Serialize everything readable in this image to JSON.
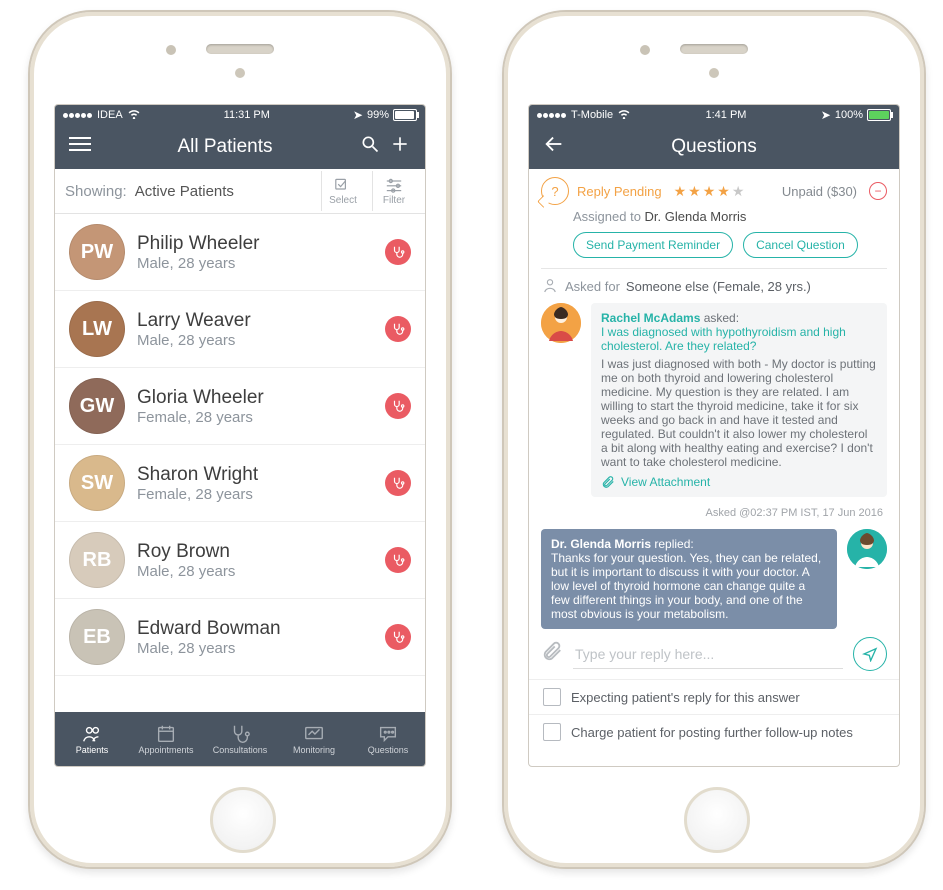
{
  "left": {
    "status": {
      "carrier": "IDEA",
      "time": "11:31 PM",
      "battery_pct": "99%",
      "battery_color": "#ffffff",
      "battery_fill": 95
    },
    "header": {
      "title": "All Patients"
    },
    "filter": {
      "showing_label": "Showing:",
      "showing_value": "Active Patients",
      "select_label": "Select",
      "filter_label": "Filter"
    },
    "patients": [
      {
        "name": "Philip Wheeler",
        "sub": "Male, 28 years",
        "initials": "PW",
        "bg": "#c49676"
      },
      {
        "name": "Larry Weaver",
        "sub": "Male, 28 years",
        "initials": "LW",
        "bg": "#a87551"
      },
      {
        "name": "Gloria Wheeler",
        "sub": "Female, 28 years",
        "initials": "GW",
        "bg": "#8f6a5a"
      },
      {
        "name": "Sharon Wright",
        "sub": "Female, 28 years",
        "initials": "SW",
        "bg": "#d9b98c"
      },
      {
        "name": "Roy Brown",
        "sub": "Male, 28 years",
        "initials": "RB",
        "bg": "#d7cbbb"
      },
      {
        "name": "Edward Bowman",
        "sub": "Male, 28 years",
        "initials": "EB",
        "bg": "#c9c3b6"
      }
    ],
    "tabs": [
      {
        "label": "Patients"
      },
      {
        "label": "Appointments"
      },
      {
        "label": "Consultations"
      },
      {
        "label": "Monitoring"
      },
      {
        "label": "Questions"
      }
    ]
  },
  "right": {
    "status": {
      "carrier": "T-Mobile",
      "time": "1:41 PM",
      "battery_pct": "100%",
      "battery_color": "#5dd25d",
      "battery_fill": 100
    },
    "header": {
      "title": "Questions"
    },
    "meta": {
      "reply_pending": "Reply Pending",
      "stars": 4,
      "stars_max": 5,
      "payment": "Unpaid ($30)",
      "assigned_label": "Assigned to ",
      "assigned_to": "Dr. Glenda Morris",
      "send_reminder": "Send Payment Reminder",
      "cancel_question": "Cancel Question",
      "asked_for_label": "Asked for ",
      "asked_for_value": "Someone else (Female, 28 yrs.)"
    },
    "question": {
      "asker": "Rachel McAdams",
      "asked_verb": " asked:",
      "topic": "I was diagnosed with hypothyroidism and high cholesterol. Are they related?",
      "body": "I was just diagnosed with both - My doctor is putting me on both thyroid and lowering cholesterol medicine. My question is they are related. I am willing to start the thyroid medicine, take it for six weeks and go back in and have it tested and regulated. But couldn't it also lower my cholesterol a bit along with healthy eating and exercise? I don't want to take cholesterol medicine.",
      "attachment_label": "View Attachment",
      "asked_time": "Asked @02:37 PM IST, 17 Jun 2016"
    },
    "reply": {
      "author": "Dr. Glenda Morris",
      "replied_verb": " replied:",
      "body": "Thanks for your question. Yes, they can be related, but it is important to discuss it with your doctor. A low level of thyroid hormone can change quite a few different things in your body, and one of the most obvious is your metabolism."
    },
    "compose": {
      "placeholder": "Type your reply here..."
    },
    "options": [
      "Expecting patient's reply for this answer",
      "Charge patient for posting further follow-up notes"
    ]
  }
}
